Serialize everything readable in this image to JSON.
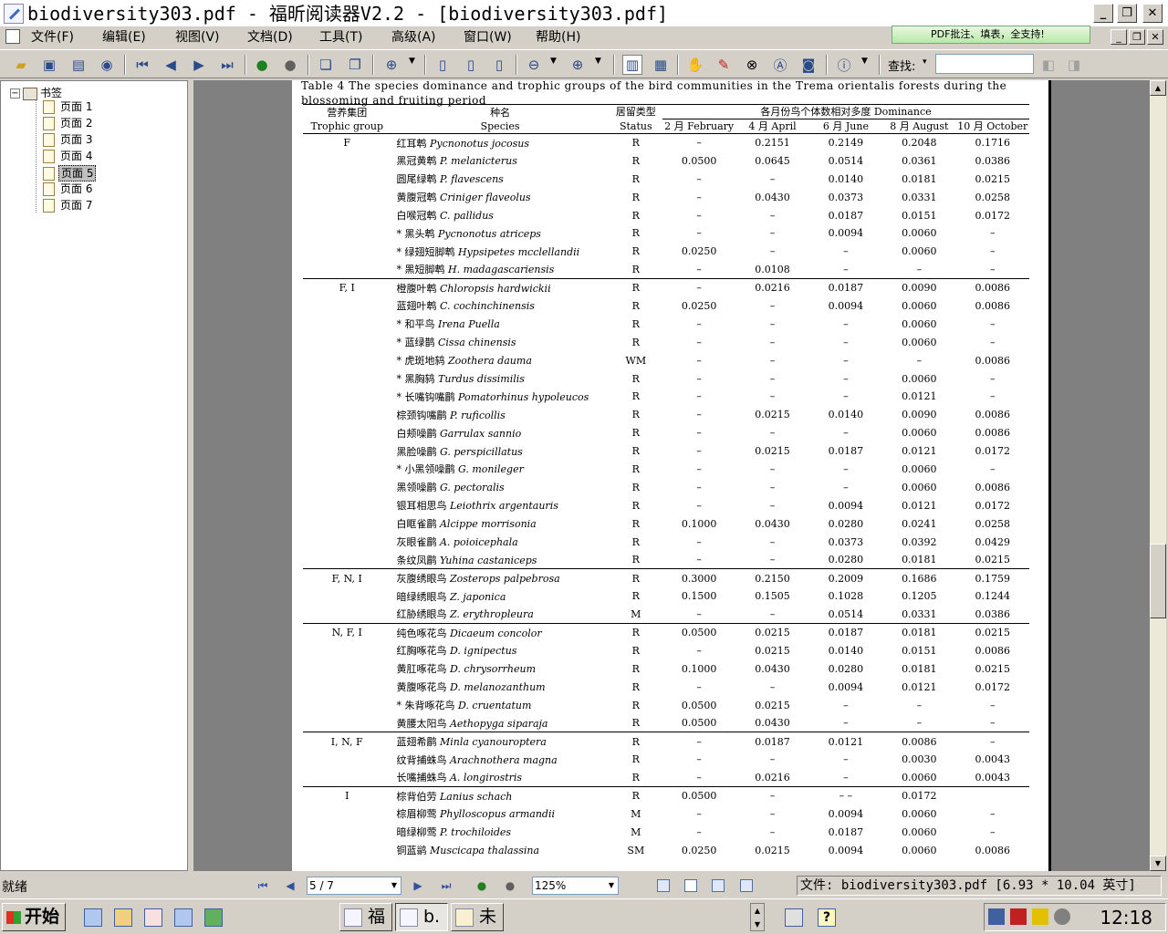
{
  "window": {
    "title": "biodiversity303.pdf - 福昕阅读器V2.2 - [biodiversity303.pdf]"
  },
  "menu": [
    "文件(F)",
    "编辑(E)",
    "视图(V)",
    "文档(D)",
    "工具(T)",
    "高级(A)",
    "窗口(W)",
    "帮助(H)"
  ],
  "promo": "PDF批注、填表，全支持!",
  "toolbar": {
    "find_label": "查找:",
    "find_value": ""
  },
  "sidebar": {
    "root": "书签",
    "items": [
      "页面 1",
      "页面 2",
      "页面 3",
      "页面 4",
      "页面 5",
      "页面 6",
      "页面 7"
    ],
    "selected_index": 4
  },
  "document": {
    "caption": "Table 4   The species dominance and trophic groups of the bird communities in the Trema orientalis forests during the blossoming and fruiting period",
    "header": {
      "group_cn": "营养集团",
      "group_en": "Trophic group",
      "species_cn": "种名",
      "species_en": "Species",
      "status_cn": "居留类型",
      "status_en": "Status",
      "dominance": "各月份鸟个体数相对多度 Dominance",
      "months": [
        "2 月 February",
        "4 月 April",
        "6 月 June",
        "8 月 August",
        "10 月 October"
      ]
    },
    "rows": [
      {
        "g": "F",
        "cn": "红耳鹎",
        "sci": "Pycnonotus jocosus",
        "st": "R",
        "v": [
          "–",
          "0.2151",
          "0.2149",
          "0.2048",
          "0.1716"
        ],
        "top": true
      },
      {
        "g": "",
        "cn": "黑冠黄鹎",
        "sci": "P. melanicterus",
        "st": "R",
        "v": [
          "0.0500",
          "0.0645",
          "0.0514",
          "0.0361",
          "0.0386"
        ]
      },
      {
        "g": "",
        "cn": "圆尾绿鹎",
        "sci": "P. flavescens",
        "st": "R",
        "v": [
          "–",
          "–",
          "0.0140",
          "0.0181",
          "0.0215"
        ]
      },
      {
        "g": "",
        "cn": "黄腹冠鹎",
        "sci": "Criniger flaveolus",
        "st": "R",
        "v": [
          "–",
          "0.0430",
          "0.0373",
          "0.0331",
          "0.0258"
        ]
      },
      {
        "g": "",
        "cn": "白喉冠鹎",
        "sci": "C. pallidus",
        "st": "R",
        "v": [
          "–",
          "–",
          "0.0187",
          "0.0151",
          "0.0172"
        ]
      },
      {
        "g": "",
        "cn": "* 黑头鹎",
        "sci": "Pycnonotus atriceps",
        "st": "R",
        "v": [
          "–",
          "–",
          "0.0094",
          "0.0060",
          "–"
        ]
      },
      {
        "g": "",
        "cn": "* 绿翅短脚鹎",
        "sci": "Hypsipetes mcclellandii",
        "st": "R",
        "v": [
          "0.0250",
          "–",
          "–",
          "0.0060",
          "–"
        ]
      },
      {
        "g": "",
        "cn": "* 黑短脚鹎",
        "sci": "H. madagascariensis",
        "st": "R",
        "v": [
          "–",
          "0.0108",
          "–",
          "–",
          "–"
        ]
      },
      {
        "g": "F, I",
        "cn": "橙腹叶鹎",
        "sci": "Chloropsis hardwickii",
        "st": "R",
        "v": [
          "–",
          "0.0216",
          "0.0187",
          "0.0090",
          "0.0086"
        ],
        "top": true
      },
      {
        "g": "",
        "cn": "蓝翅叶鹎",
        "sci": "C. cochinchinensis",
        "st": "R",
        "v": [
          "0.0250",
          "–",
          "0.0094",
          "0.0060",
          "0.0086"
        ]
      },
      {
        "g": "",
        "cn": "* 和平鸟",
        "sci": "Irena Puella",
        "st": "R",
        "v": [
          "–",
          "–",
          "–",
          "0.0060",
          "–"
        ]
      },
      {
        "g": "",
        "cn": "* 蓝绿鹊",
        "sci": "Cissa chinensis",
        "st": "R",
        "v": [
          "–",
          "–",
          "–",
          "0.0060",
          "–"
        ]
      },
      {
        "g": "",
        "cn": "* 虎斑地鸫",
        "sci": "Zoothera dauma",
        "st": "WM",
        "v": [
          "–",
          "–",
          "–",
          "–",
          "0.0086"
        ]
      },
      {
        "g": "",
        "cn": "* 黑胸鸫",
        "sci": "Turdus dissimilis",
        "st": "R",
        "v": [
          "–",
          "–",
          "–",
          "0.0060",
          "–"
        ]
      },
      {
        "g": "",
        "cn": "* 长嘴钩嘴鹛",
        "sci": "Pomatorhinus hypoleucos",
        "st": "R",
        "v": [
          "–",
          "–",
          "–",
          "0.0121",
          "–"
        ]
      },
      {
        "g": "",
        "cn": "棕颈钩嘴鹛",
        "sci": "P. ruficollis",
        "st": "R",
        "v": [
          "–",
          "0.0215",
          "0.0140",
          "0.0090",
          "0.0086"
        ]
      },
      {
        "g": "",
        "cn": "白颊噪鹛",
        "sci": "Garrulax sannio",
        "st": "R",
        "v": [
          "–",
          "–",
          "–",
          "0.0060",
          "0.0086"
        ]
      },
      {
        "g": "",
        "cn": "黑脸噪鹛",
        "sci": "G. perspicillatus",
        "st": "R",
        "v": [
          "–",
          "0.0215",
          "0.0187",
          "0.0121",
          "0.0172"
        ]
      },
      {
        "g": "",
        "cn": "* 小黑领噪鹛",
        "sci": "G. monileger",
        "st": "R",
        "v": [
          "–",
          "–",
          "–",
          "0.0060",
          "–"
        ]
      },
      {
        "g": "",
        "cn": "黑领噪鹛",
        "sci": "G. pectoralis",
        "st": "R",
        "v": [
          "–",
          "–",
          "–",
          "0.0060",
          "0.0086"
        ]
      },
      {
        "g": "",
        "cn": "银耳相思鸟",
        "sci": "Leiothrix argentauris",
        "st": "R",
        "v": [
          "–",
          "–",
          "0.0094",
          "0.0121",
          "0.0172"
        ]
      },
      {
        "g": "",
        "cn": "白眶雀鹛",
        "sci": "Alcippe morrisonia",
        "st": "R",
        "v": [
          "0.1000",
          "0.0430",
          "0.0280",
          "0.0241",
          "0.0258"
        ]
      },
      {
        "g": "",
        "cn": "灰眼雀鹛",
        "sci": "A. poioicephala",
        "st": "R",
        "v": [
          "–",
          "–",
          "0.0373",
          "0.0392",
          "0.0429"
        ]
      },
      {
        "g": "",
        "cn": "条纹凤鹛",
        "sci": "Yuhina castaniceps",
        "st": "R",
        "v": [
          "–",
          "–",
          "0.0280",
          "0.0181",
          "0.0215"
        ]
      },
      {
        "g": "F, N, I",
        "cn": "灰腹绣眼鸟",
        "sci": "Zosterops palpebrosa",
        "st": "R",
        "v": [
          "0.3000",
          "0.2150",
          "0.2009",
          "0.1686",
          "0.1759"
        ],
        "top": true
      },
      {
        "g": "",
        "cn": "暗绿绣眼鸟",
        "sci": "Z. japonica",
        "st": "R",
        "v": [
          "0.1500",
          "0.1505",
          "0.1028",
          "0.1205",
          "0.1244"
        ]
      },
      {
        "g": "",
        "cn": "红胁绣眼鸟",
        "sci": "Z. erythropleura",
        "st": "M",
        "v": [
          "–",
          "–",
          "0.0514",
          "0.0331",
          "0.0386"
        ]
      },
      {
        "g": "N, F, I",
        "cn": "纯色啄花鸟",
        "sci": "Dicaeum concolor",
        "st": "R",
        "v": [
          "0.0500",
          "0.0215",
          "0.0187",
          "0.0181",
          "0.0215"
        ],
        "top": true
      },
      {
        "g": "",
        "cn": "红胸啄花鸟",
        "sci": "D. ignipectus",
        "st": "R",
        "v": [
          "–",
          "0.0215",
          "0.0140",
          "0.0151",
          "0.0086"
        ]
      },
      {
        "g": "",
        "cn": "黄肛啄花鸟",
        "sci": "D. chrysorrheum",
        "st": "R",
        "v": [
          "0.1000",
          "0.0430",
          "0.0280",
          "0.0181",
          "0.0215"
        ]
      },
      {
        "g": "",
        "cn": "黄腹啄花鸟",
        "sci": "D. melanozanthum",
        "st": "R",
        "v": [
          "–",
          "–",
          "0.0094",
          "0.0121",
          "0.0172"
        ]
      },
      {
        "g": "",
        "cn": "* 朱背啄花鸟",
        "sci": "D. cruentatum",
        "st": "R",
        "v": [
          "0.0500",
          "0.0215",
          "–",
          "–",
          "–"
        ]
      },
      {
        "g": "",
        "cn": "黄腰太阳鸟",
        "sci": "Aethopyga siparaja",
        "st": "R",
        "v": [
          "0.0500",
          "0.0430",
          "–",
          "–",
          "–"
        ]
      },
      {
        "g": "I, N, F",
        "cn": "蓝翅希鹛",
        "sci": "Minla cyanouroptera",
        "st": "R",
        "v": [
          "–",
          "0.0187",
          "0.0121",
          "0.0086",
          "–"
        ],
        "top": true
      },
      {
        "g": "",
        "cn": "纹背捕蛛鸟",
        "sci": "Arachnothera magna",
        "st": "R",
        "v": [
          "–",
          "–",
          "–",
          "0.0030",
          "0.0043"
        ]
      },
      {
        "g": "",
        "cn": "长嘴捕蛛鸟",
        "sci": "A. longirostris",
        "st": "R",
        "v": [
          "–",
          "0.0216",
          "–",
          "0.0060",
          "0.0043"
        ]
      },
      {
        "g": "I",
        "cn": "棕背伯劳",
        "sci": "Lanius schach",
        "st": "R",
        "v": [
          "0.0500",
          "–",
          "– –",
          "0.0172",
          ""
        ],
        "top": true
      },
      {
        "g": "",
        "cn": "棕眉柳莺",
        "sci": "Phylloscopus armandii",
        "st": "M",
        "v": [
          "–",
          "–",
          "0.0094",
          "0.0060",
          "–"
        ]
      },
      {
        "g": "",
        "cn": "暗绿柳莺",
        "sci": "P. trochiloides",
        "st": "M",
        "v": [
          "–",
          "–",
          "0.0187",
          "0.0060",
          "–"
        ]
      },
      {
        "g": "",
        "cn": "铜蓝鹟",
        "sci": "Muscicapa thalassina",
        "st": "SM",
        "v": [
          "0.0250",
          "0.0215",
          "0.0094",
          "0.0060",
          "0.0086"
        ]
      }
    ]
  },
  "status": {
    "text": "就绪",
    "page": "5 / 7",
    "zoom": "125%",
    "file_info": "文件: biodiversity303.pdf [6.93 * 10.04 英寸]"
  },
  "taskbar": {
    "start": "开始",
    "tasks": [
      "福",
      "b.",
      "未"
    ],
    "clock": "12:18"
  }
}
